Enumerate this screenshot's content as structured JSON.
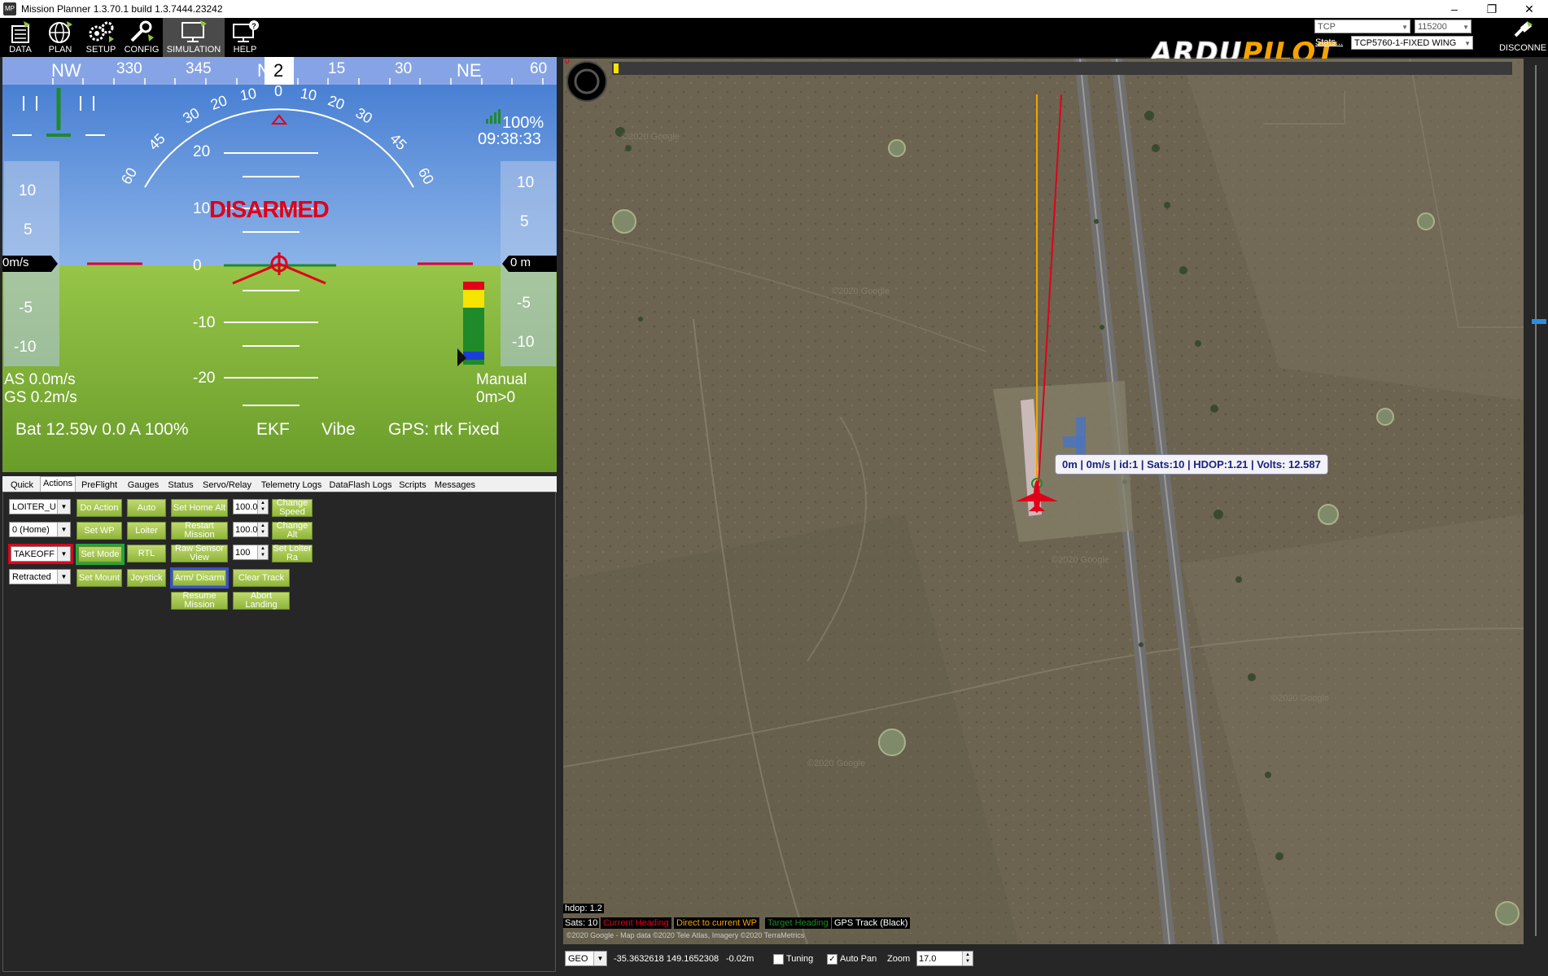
{
  "window": {
    "title": "Mission Planner 1.3.70.1 build 1.3.7444.23242",
    "app_icon_text": "MP"
  },
  "toolbar": {
    "buttons": [
      {
        "label": "DATA",
        "icon": "data-icon"
      },
      {
        "label": "PLAN",
        "icon": "globe-icon"
      },
      {
        "label": "SETUP",
        "icon": "gears-icon"
      },
      {
        "label": "CONFIG",
        "icon": "wrench-icon"
      },
      {
        "label": "SIMULATION",
        "icon": "monitor-icon",
        "active": true
      },
      {
        "label": "HELP",
        "icon": "help-monitor-icon"
      }
    ],
    "logo_part1": "ARDU",
    "logo_part2": "PILOT",
    "connection_type": "TCP",
    "baud_rate": "115200",
    "stats_link": "Stats...",
    "link_name": "TCP5760-1-FIXED WING",
    "disconnect_label": "DISCONNE"
  },
  "hud": {
    "heading_tape": [
      "NW",
      "330",
      "345",
      "N",
      "15",
      "30",
      "NE",
      "60"
    ],
    "heading_current": "2",
    "roll_labels": [
      "60",
      "45",
      "30",
      "20",
      "10",
      "0",
      "10",
      "20",
      "30",
      "45",
      "60"
    ],
    "pitch_labels": [
      "20",
      "10",
      "0",
      "-10",
      "-20"
    ],
    "status": "DISARMED",
    "signal": "100%",
    "time": "09:38:33",
    "speed_tape": [
      "10",
      "5",
      "0",
      "-5",
      "-10"
    ],
    "speed_readout": "0m/s",
    "alt_tape": [
      "10",
      "5",
      "0",
      "-5",
      "-10"
    ],
    "alt_readout": "0 m",
    "airspeed": "AS 0.0m/s",
    "groundspeed": "GS 0.2m/s",
    "mode": "Manual",
    "wp_info": "0m>0",
    "battery": "Bat 12.59v 0.0 A 100%",
    "ekf": "EKF",
    "vibe": "Vibe",
    "gps": "GPS: rtk Fixed",
    "colors": {
      "sky": "#4f86d6",
      "ground": "#8fbf3a",
      "warning": "#e0001a"
    }
  },
  "tabs": [
    "Quick",
    "Actions",
    "PreFlight",
    "Gauges",
    "Status",
    "Servo/Relay",
    "Telemetry Logs",
    "DataFlash Logs",
    "Scripts",
    "Messages"
  ],
  "active_tab": "Actions",
  "actions": {
    "dropdowns": [
      "LOITER_U",
      "0 (Home)",
      "TAKEOFF",
      "Retracted"
    ],
    "buttons": {
      "do_action": "Do Action",
      "auto": "Auto",
      "set_home_alt": "Set Home Alt",
      "change_speed": "Change Speed",
      "set_wp": "Set WP",
      "loiter": "Loiter",
      "restart_mission": "Restart Mission",
      "change_alt": "Change Alt",
      "set_mode": "Set Mode",
      "rtl": "RTL",
      "raw_sensor_view": "Raw Sensor View",
      "set_loiter_ra": "Set Loiter Ra",
      "set_mount": "Set Mount",
      "joystick": "Joystick",
      "arm_disarm": "Arm/ Disarm",
      "clear_track": "Clear Track",
      "resume_mission": "Resume Mission",
      "abort_landing": "Abort Landing"
    },
    "numeric_values": [
      "100.0",
      "100.0",
      "100"
    ]
  },
  "map": {
    "progress_marker": "0",
    "tooltip": "0m | 0m/s | id:1 | Sats:10 | HDOP:1.21 | Volts: 12.587",
    "hdop": "hdop: 1.2",
    "sats": "Sats: 10",
    "legend": [
      {
        "label": "Current Heading",
        "color": "#e0001a"
      },
      {
        "label": "Direct to current WP",
        "color": "#f5a300"
      },
      {
        "label": "Target Heading",
        "color": "#1f8a2a"
      },
      {
        "label": "GPS Track (Black)",
        "color": "#ffffff"
      }
    ],
    "copyright": "©2020 Google - Map data ©2020 Tele Atlas, Imagery ©2020 TerraMetrics",
    "watermark": "©2020 Google"
  },
  "bottom": {
    "coord_system": "GEO",
    "coords": "-35.3632618 149.1652308",
    "alt": "-0.02m",
    "tuning_label": "Tuning",
    "tuning_checked": false,
    "autopan_label": "Auto Pan",
    "autopan_checked": true,
    "zoom_label": "Zoom",
    "zoom_value": "17.0"
  }
}
